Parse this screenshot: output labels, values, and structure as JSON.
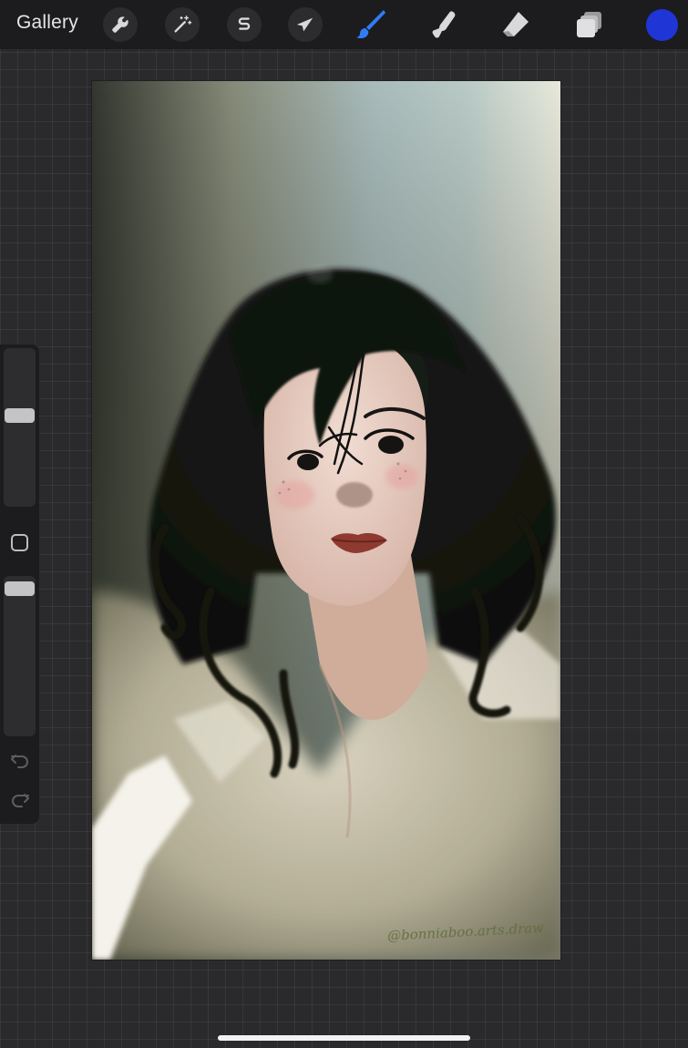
{
  "toolbar": {
    "gallery_label": "Gallery",
    "tools": [
      {
        "id": "actions",
        "icon": "wrench-icon",
        "active": false
      },
      {
        "id": "adjustments",
        "icon": "magic-wand-icon",
        "active": false
      },
      {
        "id": "selection",
        "icon": "selection-s-icon",
        "active": false
      },
      {
        "id": "transform",
        "icon": "arrow-cursor-icon",
        "active": false
      },
      {
        "id": "brush",
        "icon": "brush-icon",
        "active": true
      },
      {
        "id": "smudge",
        "icon": "smudge-finger-icon",
        "active": false
      },
      {
        "id": "eraser",
        "icon": "eraser-icon",
        "active": false
      },
      {
        "id": "layers",
        "icon": "layers-icon",
        "active": false
      }
    ],
    "current_color": "#1f35d6",
    "active_tool_color": "#2f7cf6"
  },
  "sidebar": {
    "brush_size_level": 0.59,
    "brush_opacity_level": 0.99,
    "icons": [
      "modifier-square-icon",
      "undo-icon",
      "redo-icon"
    ]
  },
  "canvas": {
    "signature_text": "@bonniaboo.arts.draw"
  }
}
